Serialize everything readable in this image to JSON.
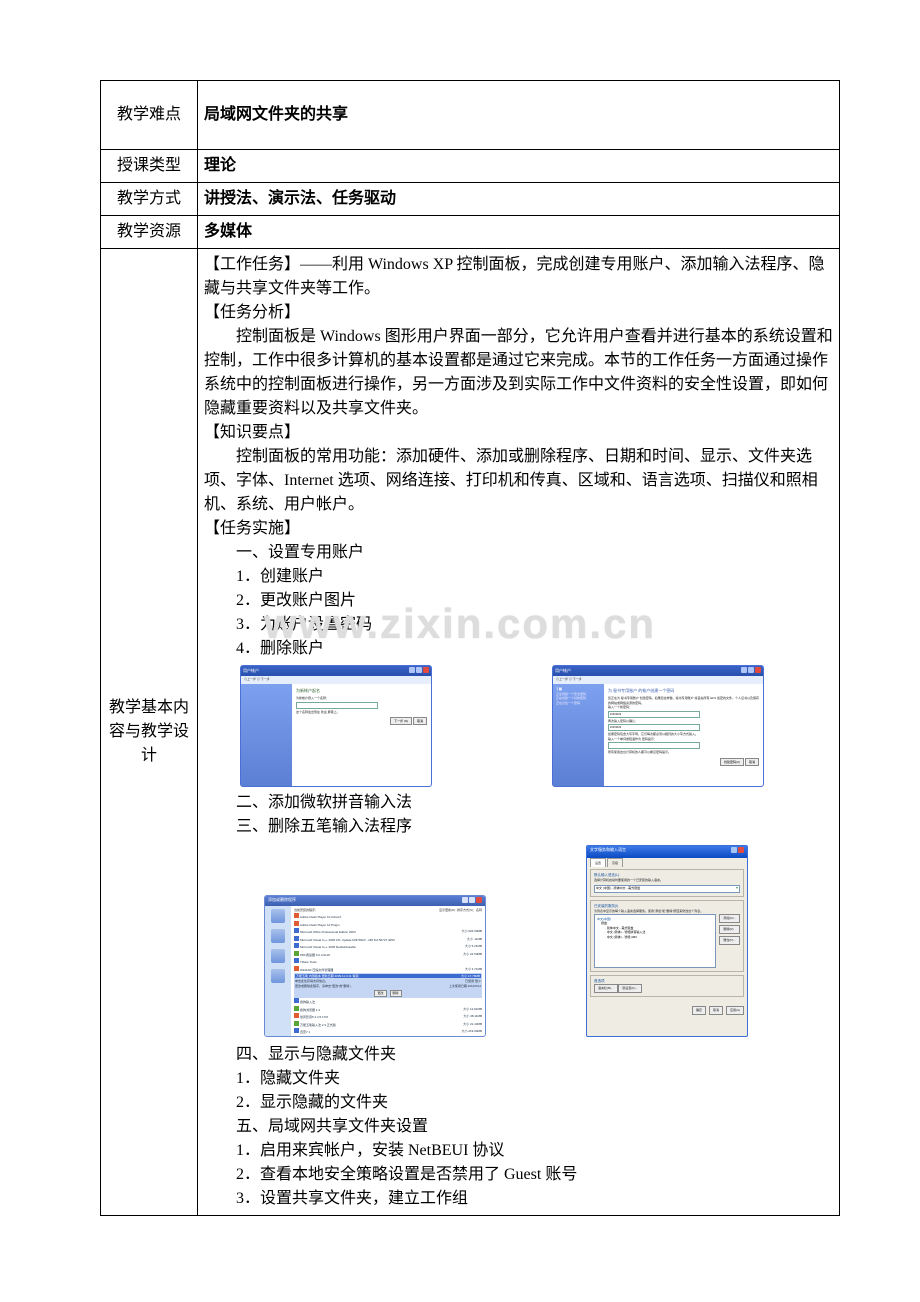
{
  "rows": {
    "difficulty_label": "教学难点",
    "difficulty_value": "局域网文件夹的共享",
    "type_label": "授课类型",
    "type_value": "理论",
    "method_label": "教学方式",
    "method_value": "讲授法、演示法、任务驱动",
    "resource_label": "教学资源",
    "resource_value": "多媒体",
    "body_label": "教学基本内容与教学设计"
  },
  "body": {
    "task_hd": "【工作任务】——利用 Windows XP 控制面板，完成创建专用账户、添加输入法程序、隐藏与共享文件夹等工作。",
    "analysis_hd": "【任务分析】",
    "analysis_text": "控制面板是 Windows 图形用户界面一部分，它允许用户查看并进行基本的系统设置和控制，工作中很多计算机的基本设置都是通过它来完成。本节的工作任务一方面通过操作系统中的控制面板进行操作，另一方面涉及到实际工作中文件资料的安全性设置，即如何隐藏重要资料以及共享文件夹。",
    "points_hd": "【知识要点】",
    "points_text": "控制面板的常用功能：添加硬件、添加或删除程序、日期和时间、显示、文件夹选项、字体、Internet 选项、网络连接、打印机和传真、区域和、语言选项、扫描仪和照相机、系统、用户帐户。",
    "impl_hd": "【任务实施】",
    "s1": "一、设置专用账户",
    "s1_1": "1．创建账户",
    "s1_2": "2．更改账户图片",
    "s1_3": "3．为账户设置密码",
    "s1_4": "4．删除账户",
    "s2": "二、添加微软拼音输入法",
    "s3": "三、删除五笔输入法程序",
    "s4": "四、显示与隐藏文件夹",
    "s4_1": "1．隐藏文件夹",
    "s4_2": "2．显示隐藏的文件夹",
    "s5": "五、局域网共享文件夹设置",
    "s5_1": "1．启用来宾帐户，安装 NetBEUI 协议",
    "s5_2": "2．查看本地安全策略设置是否禁用了 Guest 账号",
    "s5_3": "3．设置共享文件夹，建立工作组"
  },
  "watermark": "www.zixin.com.cn",
  "win_user_new": {
    "title": "用户帐户",
    "nav": "◎上一步 ◎ 下一步",
    "headline": "为新帐户起名",
    "hint1": "为新帐户键入一个名称：",
    "hint2": "这个名称会出现在 欢迎 屏幕上。",
    "btn_next": "下一步 (N)",
    "btn_cancel": "取消"
  },
  "win_user_pwd": {
    "title": "用户帐户",
    "nav": "◎上一步 ◎ 下一步",
    "side_hd": "了解",
    "side_items": [
      "正在创建一个安全密码",
      "正在创建一个好的密码",
      "正在记住一个密码"
    ],
    "headline": "为 秘书专用账户 的帐户创建一个密码",
    "hint1": "您正在为 秘书专用账户 创建密码。如果您这样做，秘书专用账户 将丢失所有 EFS 加密的文件、个人证书以及保存的网站或网络资源的密码。",
    "pw_label1": "输入一个新密码：",
    "pw_label2": "再次输入密码以确认：",
    "hint2": "如果密码包含大写字母，它们每次都必须以相同的大小写方式输入。",
    "hint3": "输入一个单词或短语作为 密码提示：",
    "hint4": "所有使用这台计算机的人都可以看见密码提示。",
    "btn_create": "创建密码(C)",
    "btn_cancel": "取消"
  },
  "arp": {
    "title": "添加或删除程序",
    "col1": "当前安装的程序：",
    "chk": "显示更新(D)",
    "sort": "排序方式(S)：名称",
    "programs": [
      {
        "name": "Adobe Flash Player 10 ActiveX",
        "size": ""
      },
      {
        "name": "Adobe Flash Player 10 Plugin",
        "size": ""
      },
      {
        "name": "Microsoft Office Professional Edition 2003",
        "size": "大小 626.00MB"
      },
      {
        "name": "Microsoft Visual C++ 2005 ATL Update kb973923 - x86 8.0.50727.4053",
        "size": "大小 .11MB"
      },
      {
        "name": "Microsoft Visual C++ 2005 Redistributable",
        "size": "大小 5.21MB"
      },
      {
        "name": "PDF阅读器 6.0.3.0118",
        "size": "大小 22.50MB"
      },
      {
        "name": "TRace Tools",
        "size": ""
      },
      {
        "name": "WinRAR 压缩文件管理器",
        "size": "大小 3.71MB"
      }
    ],
    "selected": {
      "name": "万能五笔 内测版本 更新日期 2009.11.9.11 青铜",
      "desc": "单击此处获得支持信息。",
      "link": "更改或删除此程序，请单击\"更改\"或\"删除\"。",
      "size": "大小 17.78MB",
      "used": "已使用  很少",
      "last": "上次使用日期 2010/9/14",
      "btn_change": "更改",
      "btn_remove": "删除"
    },
    "programs_after": [
      {
        "name": "搜狗输入法",
        "size": ""
      },
      {
        "name": "搜狗浏览器 1.3",
        "size": "大小 12.91MB"
      },
      {
        "name": "暴风影音5 2.2.5.17M",
        "size": "大小 38.11MB"
      },
      {
        "name": "万能五笔输入法 2.3 正式版",
        "size": "大小 21.43MB"
      },
      {
        "name": "迅雷7.1",
        "size": "大小 219.00MB"
      }
    ]
  },
  "dlg": {
    "title": "文字服务和输入语言",
    "tabs": [
      "设置",
      "高级"
    ],
    "grp1_title": "默认输入语言(L)",
    "grp1_text": "选择计算机启动时要使用的一个已安装的输入语言。",
    "grp1_drop": "中文 (中国) - 简体中文 - 美式键盘",
    "grp2_title": "已安装的服务(I)",
    "grp2_text": "为列表中显示的每个输入语言选择服务。使用\"添加\"和\"删除\"按钮来修改这个列表。",
    "tree": [
      "中文(中国)",
      "键盘",
      "· 简体中文 - 美式键盘",
      "· 中文 (简体) - 智能拼音输入法",
      "· 中文 (简体) - 智能 ABC"
    ],
    "btn_add": "添加(D)...",
    "btn_remove": "删除(R)",
    "btn_prop": "属性(P)...",
    "grp3_title": "首选项",
    "btn_lang": "语言栏(B)...",
    "btn_key": "键设置(K)...",
    "btn_ok": "确定",
    "btn_cancel": "取消",
    "btn_apply": "应用(A)"
  }
}
